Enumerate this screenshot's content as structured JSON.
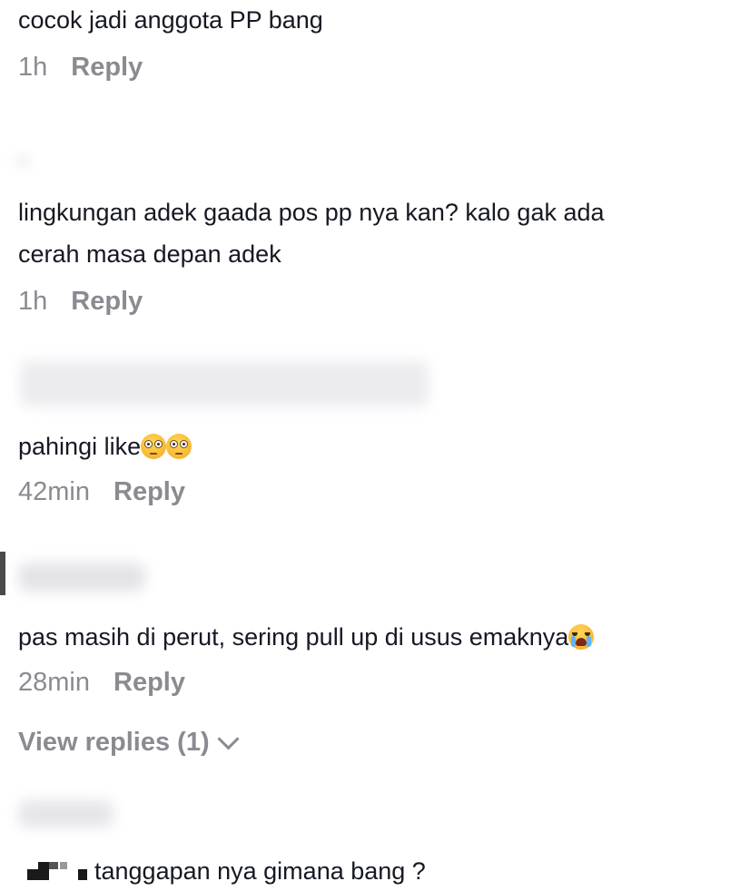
{
  "comments": [
    {
      "text": "cocok jadi anggota PP bang",
      "time": "1h",
      "reply_label": "Reply"
    },
    {
      "text_line1": "lingkungan adek gaada pos pp nya kan? kalo gak ada",
      "text_line2": "cerah masa depan adek",
      "time": "1h",
      "reply_label": "Reply"
    },
    {
      "text": "pahingi like",
      "emoji": "flushed-face-emoji",
      "time": "42min",
      "reply_label": "Reply"
    },
    {
      "text": "pas masih di perut, sering pull up di usus emaknya",
      "emoji": "loudly-crying-face-emoji",
      "time": "28min",
      "reply_label": "Reply",
      "view_replies_label": "View replies (1)"
    },
    {
      "text": "tanggapan nya gimana bang ?"
    }
  ],
  "colors": {
    "text": "#161823",
    "meta": "#8a8b91",
    "background": "#ffffff"
  }
}
